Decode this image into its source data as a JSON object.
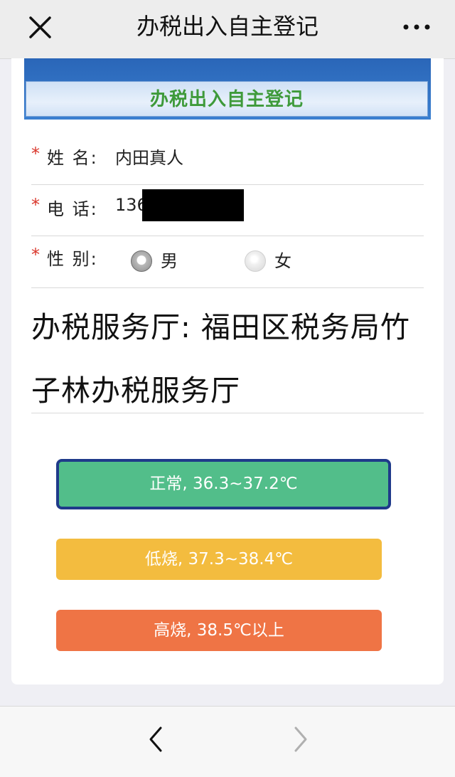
{
  "nav": {
    "title": "办税出入自主登记",
    "close_icon": "close-icon",
    "more_icon": "more-icon"
  },
  "banner": {
    "subtitle": "办税出入自主登记"
  },
  "form": {
    "name": {
      "required_mark": "*",
      "label": "姓 名:",
      "value": "内田真人"
    },
    "phone": {
      "required_mark": "*",
      "label": "电 话:",
      "value": "136"
    },
    "gender": {
      "required_mark": "*",
      "label": "性 别:",
      "options": [
        {
          "label": "男",
          "checked": true
        },
        {
          "label": "女",
          "checked": false
        }
      ]
    }
  },
  "hall": {
    "text": "办税服务厅:  福田区税务局竹子林办税服务厅"
  },
  "temperature": {
    "normal": {
      "label": "正常, 36.3~37.2℃",
      "color": "#52be8a",
      "selected": true
    },
    "low": {
      "label": "低烧, 37.3~38.4℃",
      "color": "#f3bc3f"
    },
    "high": {
      "label": "高烧, 38.5℃以上",
      "color": "#ef7445"
    }
  },
  "toolbar": {
    "back_icon": "chevron-left-icon",
    "forward_icon": "chevron-right-icon"
  }
}
